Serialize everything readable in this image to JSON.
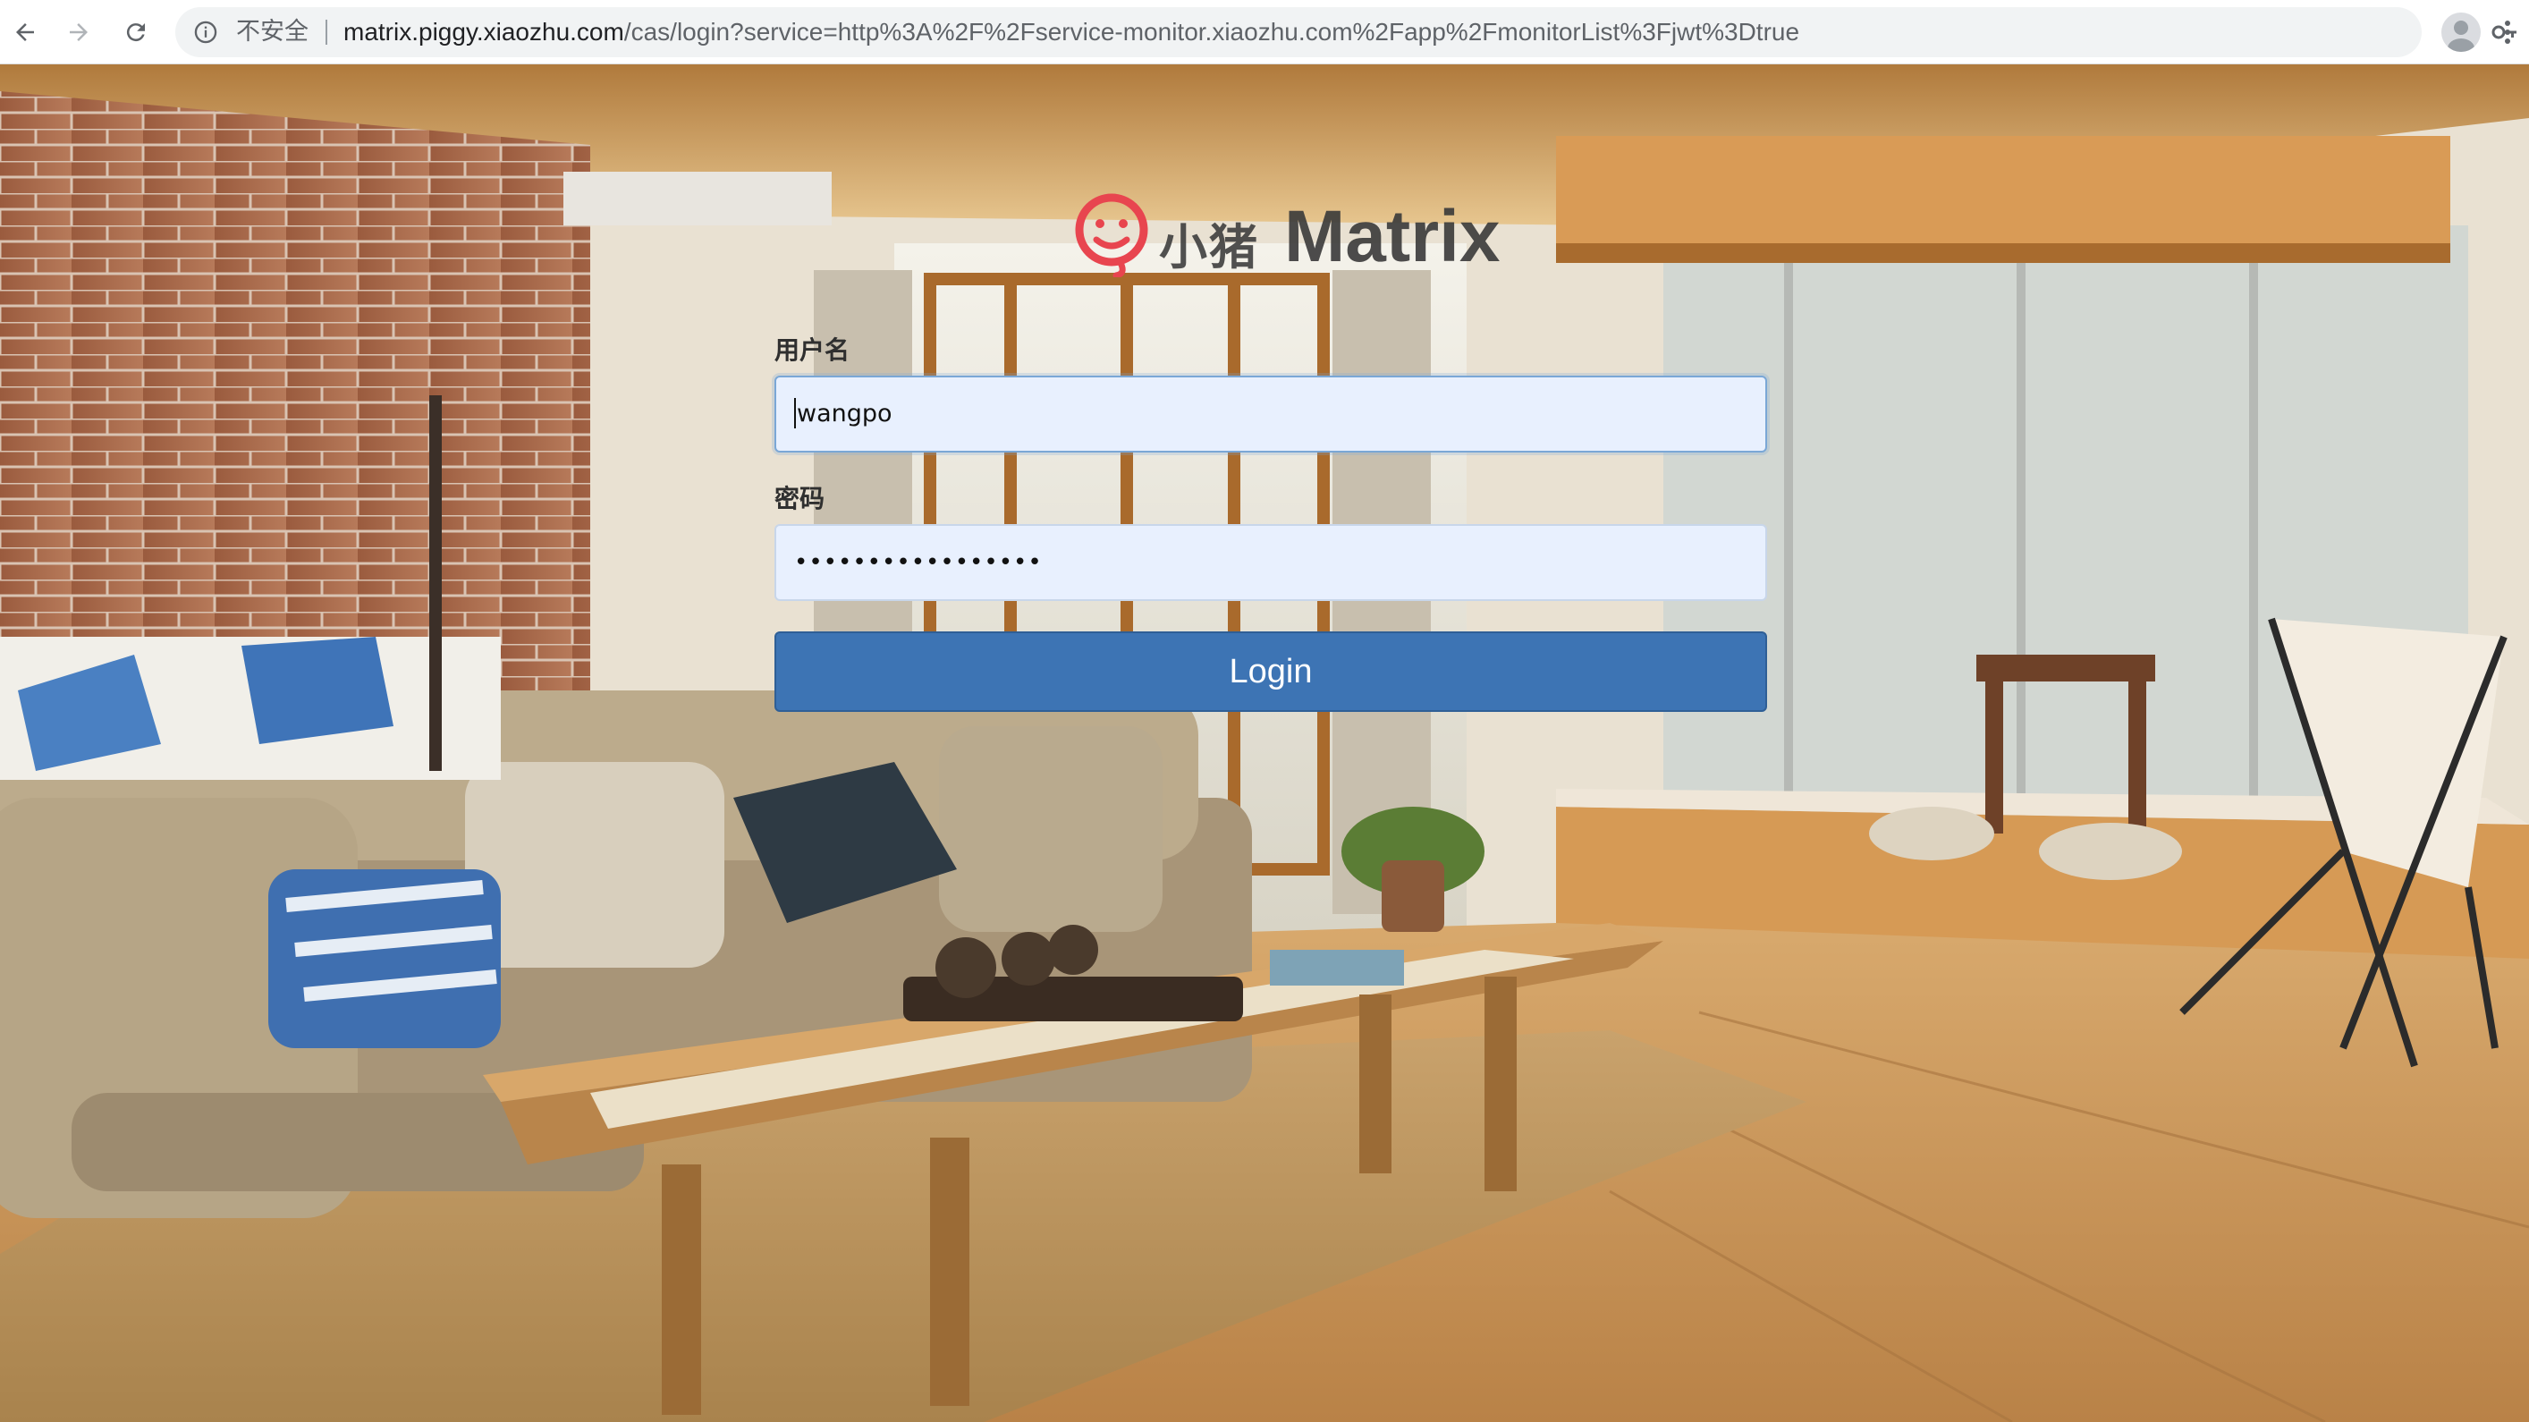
{
  "browser": {
    "insecure_label": "不安全",
    "url_host": "matrix.piggy.xiaozhu.com",
    "url_path": "/cas/login?service=http%3A%2F%2Fservice-monitor.xiaozhu.com%2Fapp%2FmonitorList%3Fjwt%3Dtrue",
    "icons": [
      "back-arrow-icon",
      "forward-arrow-icon",
      "reload-icon",
      "info-icon",
      "key-icon",
      "star-icon",
      "profile-avatar-icon",
      "menu-dots-icon"
    ]
  },
  "logo": {
    "chinese_text": "小猪",
    "english_text": "Matrix",
    "mascot_icon": "pig-face-icon",
    "accent_color": "#e8454f"
  },
  "form": {
    "username_label": "用户名",
    "username_value": "wangpo",
    "password_label": "密码",
    "password_masked": "•••••••••••••••••",
    "login_label": "Login",
    "button_color": "#3d74b4",
    "input_fill_color": "#e8f0fe"
  }
}
